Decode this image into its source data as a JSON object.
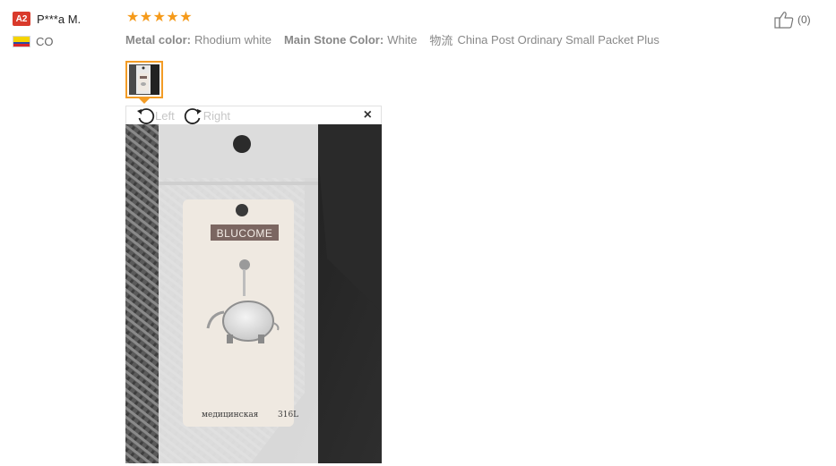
{
  "reviewer": {
    "level_badge": "A2",
    "name": "P***a M.",
    "country_code": "CO",
    "flag_colors": [
      "#f5d400",
      "#2a4ba8",
      "#d9262b"
    ]
  },
  "rating": {
    "stars": 5,
    "max": 5,
    "color": "#f59a1a"
  },
  "attributes": [
    {
      "label": "Metal color:",
      "value": "Rhodium white"
    },
    {
      "label": "Main Stone Color:",
      "value": "White"
    }
  ],
  "shipping": {
    "label": "物流",
    "value": "China Post Ordinary Small Packet Plus"
  },
  "helpful": {
    "icon": "thumbs-up-icon",
    "count": "(0)"
  },
  "viewer": {
    "rotate_left_label": "Left",
    "rotate_right_label": "Right",
    "close_label": "×",
    "package_brand": "BLUCOME",
    "package_text_cyrillic": "медицинская",
    "package_text_code": "316L"
  },
  "colors": {
    "accent": "#f39c25",
    "badge": "#d93a2b"
  }
}
